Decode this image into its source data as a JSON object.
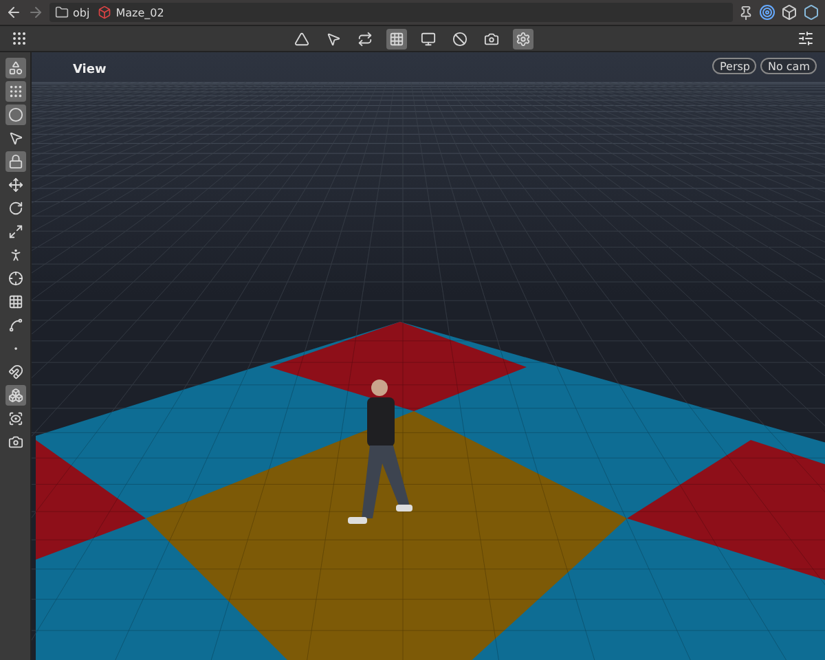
{
  "path_bar": {
    "crumbs": [
      {
        "label": "obj",
        "kind": "folder"
      },
      {
        "label": "Maze_02",
        "kind": "object"
      }
    ]
  },
  "viewport": {
    "title": "View",
    "buttons": [
      {
        "label": "Persp"
      },
      {
        "label": "No cam"
      }
    ]
  },
  "toolbar": {
    "tools": [
      {
        "kind": "mesh",
        "selected": false
      },
      {
        "kind": "pointer",
        "selected": false
      },
      {
        "kind": "swap",
        "selected": false
      },
      {
        "kind": "grid",
        "selected": true
      },
      {
        "kind": "screen",
        "selected": false
      },
      {
        "kind": "disabled",
        "selected": false
      },
      {
        "kind": "camera",
        "selected": false
      },
      {
        "kind": "gear",
        "selected": true
      }
    ]
  },
  "side_tools": [
    {
      "kind": "shape",
      "selected": true
    },
    {
      "kind": "dots",
      "selected": true
    },
    {
      "kind": "sphere",
      "selected": true
    },
    {
      "kind": "pointer",
      "selected": false
    },
    {
      "kind": "lock",
      "selected": true
    },
    {
      "kind": "move",
      "selected": false
    },
    {
      "kind": "rotate",
      "selected": false
    },
    {
      "kind": "scale",
      "selected": false
    },
    {
      "kind": "pose",
      "selected": false
    },
    {
      "kind": "handle",
      "selected": false
    },
    {
      "kind": "snapgrid",
      "selected": false
    },
    {
      "kind": "snapcurve",
      "selected": false
    },
    {
      "kind": "snappoint",
      "selected": false
    },
    {
      "kind": "magnet",
      "selected": false
    },
    {
      "kind": "group",
      "selected": true
    },
    {
      "kind": "view",
      "selected": false
    },
    {
      "kind": "camera",
      "selected": false
    }
  ]
}
